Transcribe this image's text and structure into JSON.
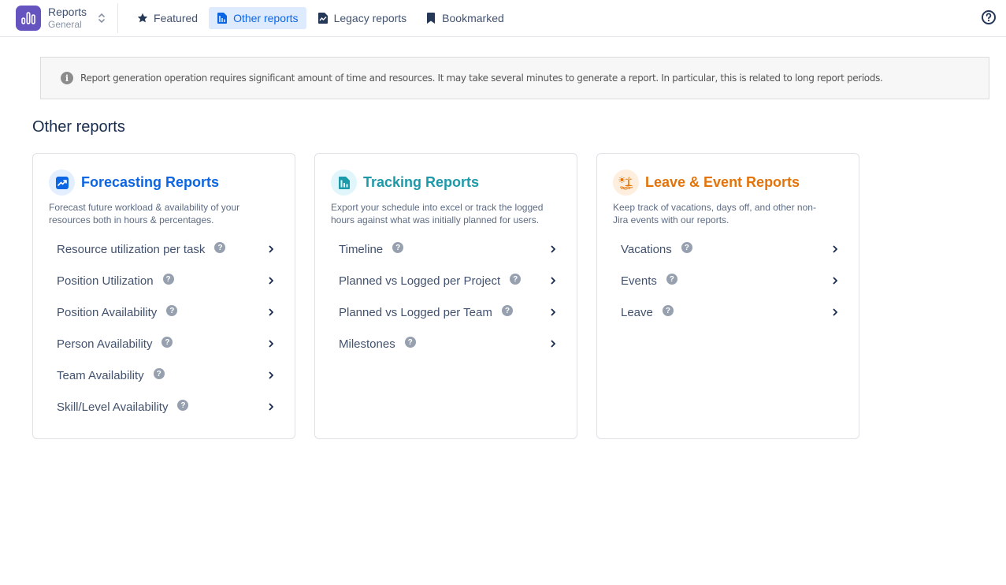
{
  "app": {
    "name": "Reports",
    "subtitle": "General",
    "logo_icon": "bar-chart-icon",
    "brand_color": "#6554c0"
  },
  "nav": {
    "items": [
      {
        "label": "Featured",
        "icon": "star-icon",
        "active": false
      },
      {
        "label": "Other reports",
        "icon": "report-chart-icon",
        "active": true
      },
      {
        "label": "Legacy reports",
        "icon": "legacy-document-icon",
        "active": false
      },
      {
        "label": "Bookmarked",
        "icon": "bookmark-icon",
        "active": false
      }
    ],
    "help_icon": "help-circle-icon"
  },
  "banner": {
    "icon": "info-icon",
    "text": "Report generation operation requires significant amount of time and resources. It may take several minutes to generate a report. In particular, this is related to long report periods."
  },
  "page_title": "Other reports",
  "cards": [
    {
      "title": "Forecasting Reports",
      "icon": "trend-up-icon",
      "accent": "#0c66e4",
      "description": "Forecast future workload & availability of your resources both in hours & percentages.",
      "items": [
        {
          "label": "Resource utilization per task"
        },
        {
          "label": "Position Utilization"
        },
        {
          "label": "Position Availability"
        },
        {
          "label": "Person Availability"
        },
        {
          "label": "Team Availability"
        },
        {
          "label": "Skill/Level Availability"
        }
      ]
    },
    {
      "title": "Tracking Reports",
      "icon": "tracking-report-icon",
      "accent": "#1d9aaa",
      "description": "Export your schedule into excel or track the logged hours against what was initially planned for users.",
      "items": [
        {
          "label": "Timeline"
        },
        {
          "label": "Planned vs Logged per Project"
        },
        {
          "label": "Planned vs Logged per Team"
        },
        {
          "label": "Milestones"
        }
      ]
    },
    {
      "title": "Leave & Event Reports",
      "icon": "island-vacation-icon",
      "accent": "#e2740b",
      "description": "Keep track of vacations, days off, and other non-Jira events with our reports.",
      "items": [
        {
          "label": "Vacations"
        },
        {
          "label": "Events"
        },
        {
          "label": "Leave"
        }
      ]
    }
  ],
  "help_glyph": "?"
}
